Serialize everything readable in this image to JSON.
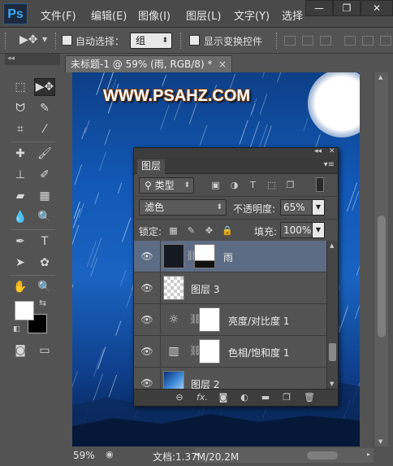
{
  "app": {
    "logo": "Ps",
    "accent": "#39a8f6"
  },
  "menu": [
    "文件(F)",
    "编辑(E)",
    "图像(I)",
    "图层(L)",
    "文字(Y)",
    "选择"
  ],
  "window_controls": {
    "minimize": "—",
    "restore": "❐",
    "close": "✕"
  },
  "options_bar": {
    "auto_select_label": "自动选择：",
    "auto_select_checked": false,
    "auto_select_value": "组",
    "show_transform_label": "显示变换控件",
    "show_transform_checked": false
  },
  "document": {
    "tab_title": "未标题-1 @ 59% (雨, RGB/8) *",
    "close": "×",
    "watermark_text": "WWW.PSAHZ.COM"
  },
  "status_bar": {
    "zoom": "59%",
    "doc_info": "文档:1.37M/20.2M"
  },
  "colors": {
    "foreground": "#ffffff",
    "background": "#000000"
  },
  "layers_panel": {
    "tab": "图层",
    "filter_label": "类型",
    "blend_mode": "滤色",
    "opacity_label": "不透明度:",
    "opacity_value": "65%",
    "lock_label": "锁定:",
    "fill_label": "填充:",
    "fill_value": "100%",
    "layers": [
      {
        "name": "雨",
        "selected": true,
        "visible": true,
        "kind": "mask"
      },
      {
        "name": "图层 3",
        "selected": false,
        "visible": true,
        "kind": "pixel"
      },
      {
        "name": "亮度/对比度 1",
        "selected": false,
        "visible": true,
        "kind": "adjustment"
      },
      {
        "name": "色相/饱和度 1",
        "selected": false,
        "visible": true,
        "kind": "adjustment"
      },
      {
        "name": "图层 2",
        "selected": false,
        "visible": true,
        "kind": "gradient"
      }
    ],
    "footer_icons": [
      "link-icon",
      "fx-icon",
      "add-mask-icon",
      "adjustment-icon",
      "group-icon",
      "new-layer-icon",
      "trash-icon"
    ]
  }
}
